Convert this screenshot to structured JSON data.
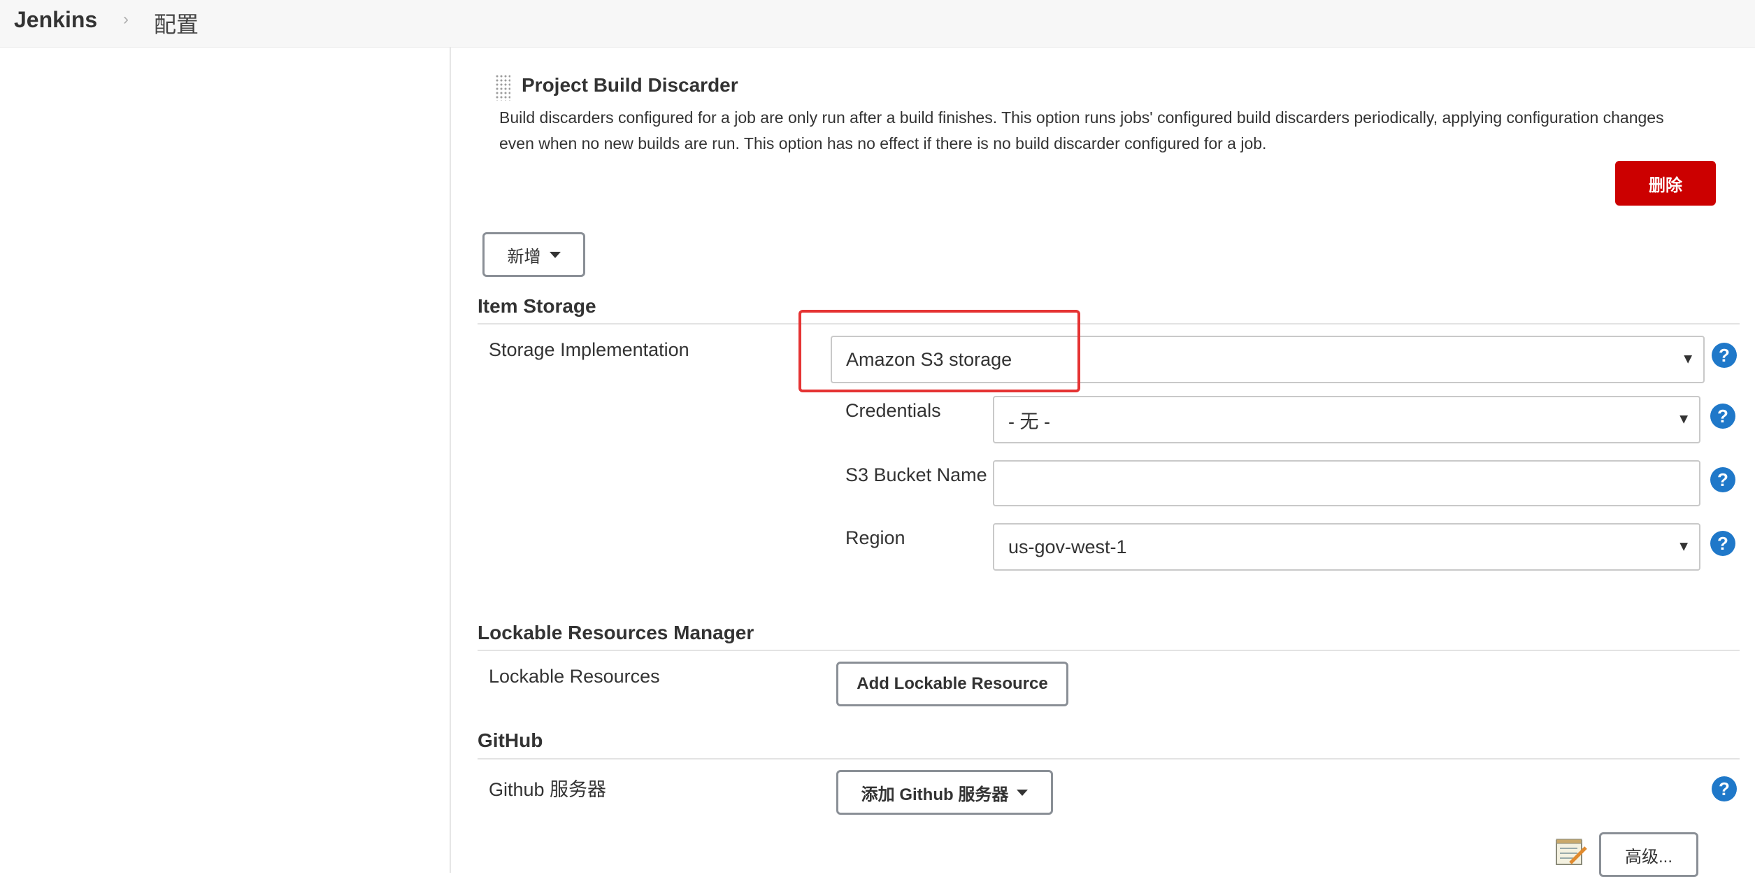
{
  "header": {
    "brand": "Jenkins",
    "separator": "›",
    "breadcrumb": "配置"
  },
  "build_discarder": {
    "title": "Project Build Discarder",
    "description": "Build discarders configured for a job are only run after a build finishes. This option runs jobs' configured build discarders periodically, applying configuration changes even when no new builds are run. This option has no effect if there is no build discarder configured for a job.",
    "delete_label": "删除"
  },
  "add_button": {
    "label": "新增"
  },
  "item_storage": {
    "heading": "Item Storage",
    "storage_label": "Storage Implementation",
    "storage_value": "Amazon S3 storage",
    "credentials_label": "Credentials",
    "credentials_value": "- 无 -",
    "bucket_label": "S3 Bucket Name",
    "bucket_value": "",
    "region_label": "Region",
    "region_value": "us-gov-west-1"
  },
  "lockable": {
    "heading": "Lockable Resources Manager",
    "label": "Lockable Resources",
    "button": "Add Lockable Resource"
  },
  "github": {
    "heading": "GitHub",
    "label": "Github 服务器",
    "button": "添加 Github 服务器"
  },
  "advanced": {
    "label": "高级..."
  },
  "icons": {
    "help": "?",
    "dropdown": "▼"
  },
  "colors": {
    "danger": "#cc0000",
    "help": "#1f78c9",
    "highlight": "#e53333"
  }
}
